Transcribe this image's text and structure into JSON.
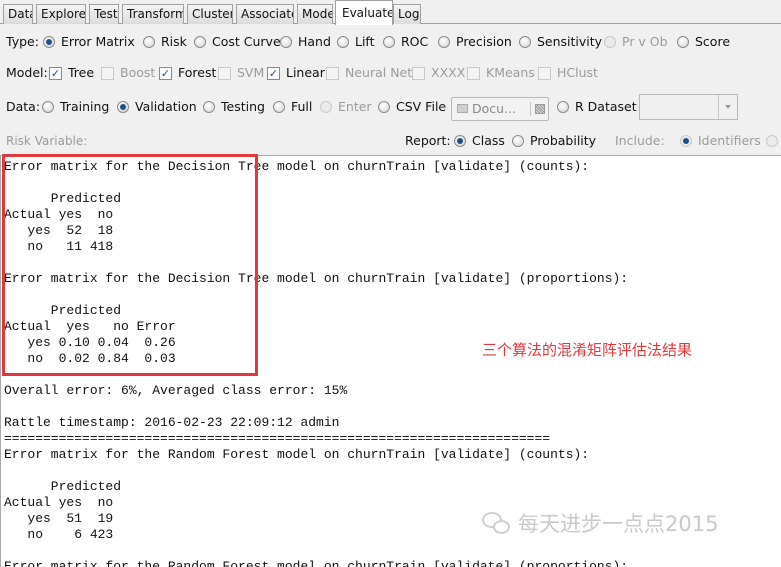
{
  "tabs": [
    {
      "label": "Data",
      "active": false
    },
    {
      "label": "Explore",
      "active": false
    },
    {
      "label": "Test",
      "active": false
    },
    {
      "label": "Transform",
      "active": false
    },
    {
      "label": "Cluster",
      "active": false
    },
    {
      "label": "Associate",
      "active": false
    },
    {
      "label": "Model",
      "active": false
    },
    {
      "label": "Evaluate",
      "active": true
    },
    {
      "label": "Log",
      "active": false
    }
  ],
  "type_row": {
    "label": "Type:",
    "options": [
      {
        "label": "Error Matrix",
        "selected": true,
        "enabled": true
      },
      {
        "label": "Risk",
        "selected": false,
        "enabled": true
      },
      {
        "label": "Cost Curve",
        "selected": false,
        "enabled": true
      },
      {
        "label": "Hand",
        "selected": false,
        "enabled": true
      },
      {
        "label": "Lift",
        "selected": false,
        "enabled": true
      },
      {
        "label": "ROC",
        "selected": false,
        "enabled": true
      },
      {
        "label": "Precision",
        "selected": false,
        "enabled": true
      },
      {
        "label": "Sensitivity",
        "selected": false,
        "enabled": true
      },
      {
        "label": "Pr v Ob",
        "selected": false,
        "enabled": false
      },
      {
        "label": "Score",
        "selected": false,
        "enabled": true
      }
    ]
  },
  "model_row": {
    "label": "Model:",
    "options": [
      {
        "label": "Tree",
        "checked": true,
        "enabled": true
      },
      {
        "label": "Boost",
        "checked": false,
        "enabled": false
      },
      {
        "label": "Forest",
        "checked": true,
        "enabled": true
      },
      {
        "label": "SVM",
        "checked": false,
        "enabled": false
      },
      {
        "label": "Linear",
        "checked": true,
        "enabled": true
      },
      {
        "label": "Neural Net",
        "checked": false,
        "enabled": false
      },
      {
        "label": "XXXX",
        "checked": false,
        "enabled": false
      },
      {
        "label": "KMeans",
        "checked": false,
        "enabled": false
      },
      {
        "label": "HClust",
        "checked": false,
        "enabled": false
      }
    ]
  },
  "data_row": {
    "label": "Data:",
    "options": [
      {
        "label": "Training",
        "selected": false,
        "enabled": true
      },
      {
        "label": "Validation",
        "selected": true,
        "enabled": true
      },
      {
        "label": "Testing",
        "selected": false,
        "enabled": true
      },
      {
        "label": "Full",
        "selected": false,
        "enabled": true
      },
      {
        "label": "Enter",
        "selected": false,
        "enabled": false
      },
      {
        "label": "CSV File",
        "selected": false,
        "enabled": true
      }
    ],
    "file_button": "Docu...",
    "rdataset_label": "R Dataset",
    "rdataset_value": ""
  },
  "risk_row": {
    "risk_label": "Risk Variable:",
    "report_label": "Report:",
    "report_options": [
      {
        "label": "Class",
        "selected": true
      },
      {
        "label": "Probability",
        "selected": false
      }
    ],
    "include_label": "Include:",
    "include_options": [
      {
        "label": "Identifiers",
        "selected": true
      }
    ]
  },
  "output_text": "Error matrix for the Decision Tree model on churnTrain [validate] (counts):\n\n      Predicted\nActual yes  no\n   yes  52  18\n   no   11 418\n\nError matrix for the Decision Tree model on churnTrain [validate] (proportions):\n\n      Predicted\nActual  yes   no Error\n   yes 0.10 0.04  0.26\n   no  0.02 0.84  0.03\n\nOverall error: 6%, Averaged class error: 15%\n\nRattle timestamp: 2016-02-23 22:09:12 admin\n======================================================================\nError matrix for the Random Forest model on churnTrain [validate] (counts):\n\n      Predicted\nActual yes  no\n   yes  51  19\n   no    6 423\n\nError matrix for the Random Forest model on churnTrain [validate] (proportions):",
  "annotation": "三个算法的混淆矩阵评估法结果",
  "watermark": "每天进步一点点2015",
  "colors": {
    "highlight_red": "#e0393b",
    "radio_selected": "#1f4f87"
  }
}
